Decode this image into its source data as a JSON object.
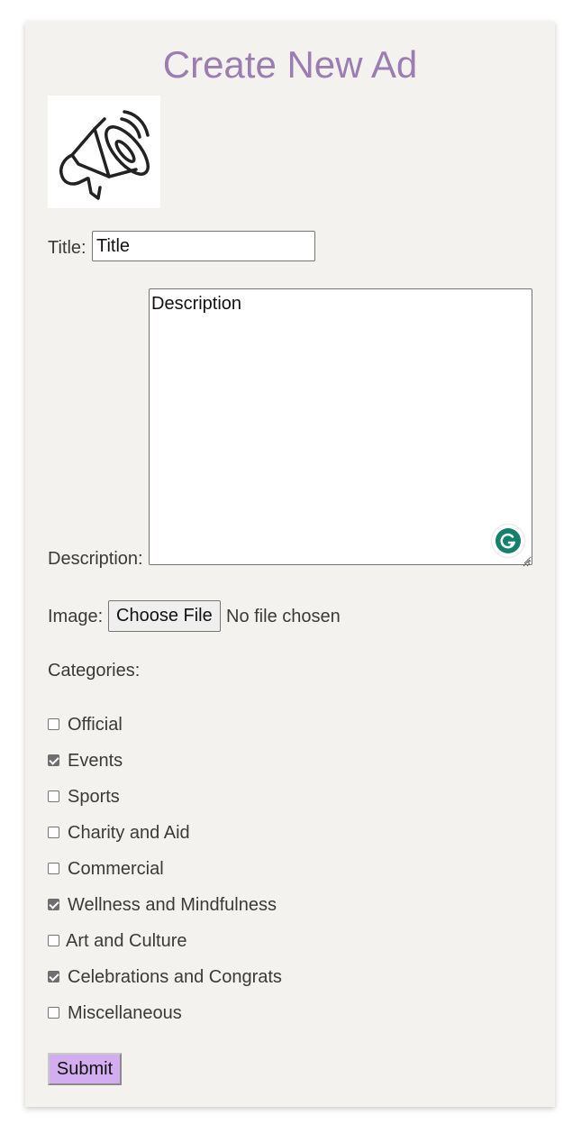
{
  "page": {
    "heading": "Create New Ad",
    "heading_color": "#9b7db1",
    "logo_icon": "megaphone-icon"
  },
  "form": {
    "title_label": "Title:",
    "title_value": "Title",
    "description_label": "Description:",
    "description_value": "Description",
    "image_label": "Image:",
    "choose_file_label": "Choose File",
    "file_status": "No file chosen",
    "categories_label": "Categories:",
    "categories": [
      {
        "label": "Official",
        "checked": false
      },
      {
        "label": "Events",
        "checked": true
      },
      {
        "label": "Sports",
        "checked": false
      },
      {
        "label": "Charity and Aid",
        "checked": false
      },
      {
        "label": "Commercial",
        "checked": false
      },
      {
        "label": "Wellness and Mindfulness",
        "checked": true
      },
      {
        "label": "Art and Culture",
        "checked": false
      },
      {
        "label": "Celebrations and Congrats",
        "checked": true
      },
      {
        "label": "Miscellaneous",
        "checked": false
      }
    ],
    "submit_label": "Submit",
    "submit_color": "#d2aef0"
  },
  "extensions": {
    "grammarly_icon": "grammarly-icon",
    "grammarly_color": "#15806b"
  }
}
